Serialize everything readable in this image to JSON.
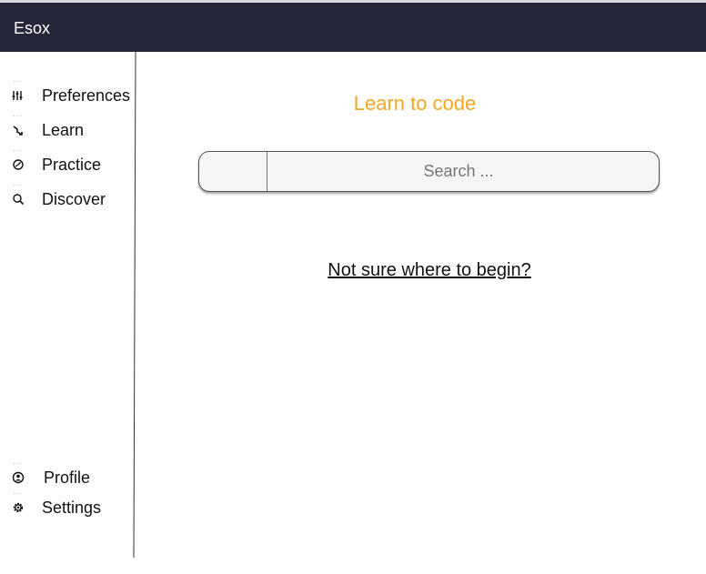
{
  "app": {
    "name": "Esox"
  },
  "sidebar": {
    "items": [
      {
        "label": "Preferences",
        "icon": "sliders-icon"
      },
      {
        "label": "Learn",
        "icon": "arrow-icon"
      },
      {
        "label": "Practice",
        "icon": "dial-icon"
      },
      {
        "label": "Discover",
        "icon": "search-icon"
      }
    ],
    "bottom_items": [
      {
        "label": "Profile",
        "icon": "user-circle-icon"
      },
      {
        "label": "Settings",
        "icon": "gear-icon"
      }
    ]
  },
  "main": {
    "title": "Learn to code",
    "search": {
      "placeholder": "Search ..."
    },
    "help_link": "Not sure where to begin?"
  },
  "colors": {
    "topbar": "#25263a",
    "accent": "#f5a623"
  }
}
